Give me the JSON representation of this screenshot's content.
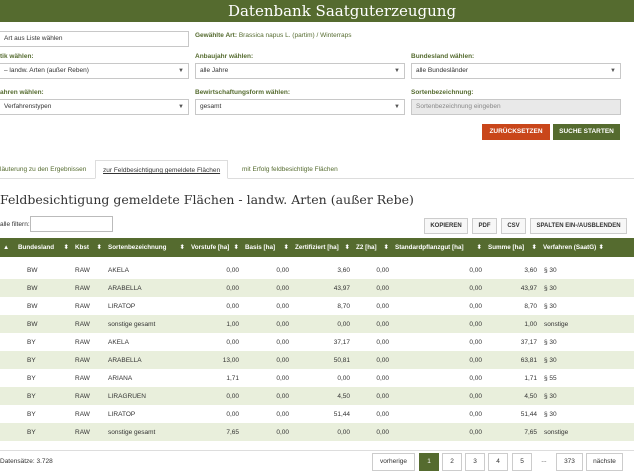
{
  "header": {
    "title": "Datenbank Saatguterzeugung"
  },
  "form": {
    "art_select": "Art aus Liste wählen",
    "gewaehlte_art_label": "Gewählte Art:",
    "gewaehlte_art_value": "Brassica napus L. (partim) / Winterraps",
    "statistik_label": "tik wählen:",
    "statistik_value": "– landw. Arten (außer Reben)",
    "anbaujahr_label": "Anbaujahr wählen:",
    "anbaujahr_value": "alle Jahre",
    "bundesland_label": "Bundesland wählen:",
    "bundesland_value": "alle Bundesländer",
    "verfahren_label": "ahren wählen:",
    "verfahren_value": "Verfahrenstypen",
    "bewirtschaftung_label": "Bewirtschaftungsform wählen:",
    "bewirtschaftung_value": "gesamt",
    "sorte_label": "Sortenbezeichnung:",
    "sorte_placeholder": "Sortenbezeichnung eingeben",
    "reset_label": "ZURÜCKSETZEN",
    "search_label": "SUCHE STARTEN"
  },
  "tabs": [
    {
      "label": "läuterung zu den Ergebnissen"
    },
    {
      "label": "zur Feldbesichtigung gemeldete Flächen"
    },
    {
      "label": "mit Erfolg feldbesichtigte Flächen"
    }
  ],
  "section_title": "Feldbesichtigung gemeldete Flächen - landw. Arten (außer Rebe)",
  "filter_label": "alle filtern:",
  "toolbar": {
    "kopieren": "KOPIEREN",
    "pdf": "PDF",
    "csv": "CSV",
    "spalten": "SPALTEN EIN-/AUSBLENDEN"
  },
  "table": {
    "columns": [
      "Bundesland",
      "Kbst",
      "Sortenbezeichnung",
      "Vorstufe [ha]",
      "Basis [ha]",
      "Zertifiziert [ha]",
      "Z2 [ha]",
      "Standardpflanzgut [ha]",
      "Summe [ha]",
      "Verfahren (SaatG)"
    ],
    "rows": [
      [
        "BW",
        "RAW",
        "AKELA",
        "0,00",
        "0,00",
        "3,60",
        "0,00",
        "0,00",
        "3,60",
        "§ 30"
      ],
      [
        "BW",
        "RAW",
        "ARABELLA",
        "0,00",
        "0,00",
        "43,97",
        "0,00",
        "0,00",
        "43,97",
        "§ 30"
      ],
      [
        "BW",
        "RAW",
        "LIRATOP",
        "0,00",
        "0,00",
        "8,70",
        "0,00",
        "0,00",
        "8,70",
        "§ 30"
      ],
      [
        "BW",
        "RAW",
        "sonstige gesamt",
        "1,00",
        "0,00",
        "0,00",
        "0,00",
        "0,00",
        "1,00",
        "sonstige"
      ],
      [
        "BY",
        "RAW",
        "AKELA",
        "0,00",
        "0,00",
        "37,17",
        "0,00",
        "0,00",
        "37,17",
        "§ 30"
      ],
      [
        "BY",
        "RAW",
        "ARABELLA",
        "13,00",
        "0,00",
        "50,81",
        "0,00",
        "0,00",
        "63,81",
        "§ 30"
      ],
      [
        "BY",
        "RAW",
        "ARIANA",
        "1,71",
        "0,00",
        "0,00",
        "0,00",
        "0,00",
        "1,71",
        "§ 55"
      ],
      [
        "BY",
        "RAW",
        "LIRAGRUEN",
        "0,00",
        "0,00",
        "4,50",
        "0,00",
        "0,00",
        "4,50",
        "§ 30"
      ],
      [
        "BY",
        "RAW",
        "LIRATOP",
        "0,00",
        "0,00",
        "51,44",
        "0,00",
        "0,00",
        "51,44",
        "§ 30"
      ],
      [
        "BY",
        "RAW",
        "sonstige gesamt",
        "7,65",
        "0,00",
        "0,00",
        "0,00",
        "0,00",
        "7,65",
        "sonstige"
      ]
    ]
  },
  "footer": {
    "info": "Datensätze: 3.728",
    "prev": "vorherige",
    "pages": [
      "1",
      "2",
      "3",
      "4",
      "5"
    ],
    "dots": "...",
    "last": "373",
    "next": "nächste"
  },
  "colors": {
    "brand_green": "#556b2f",
    "reset_orange": "#c9461a",
    "row_alt": "#e9efdc"
  }
}
